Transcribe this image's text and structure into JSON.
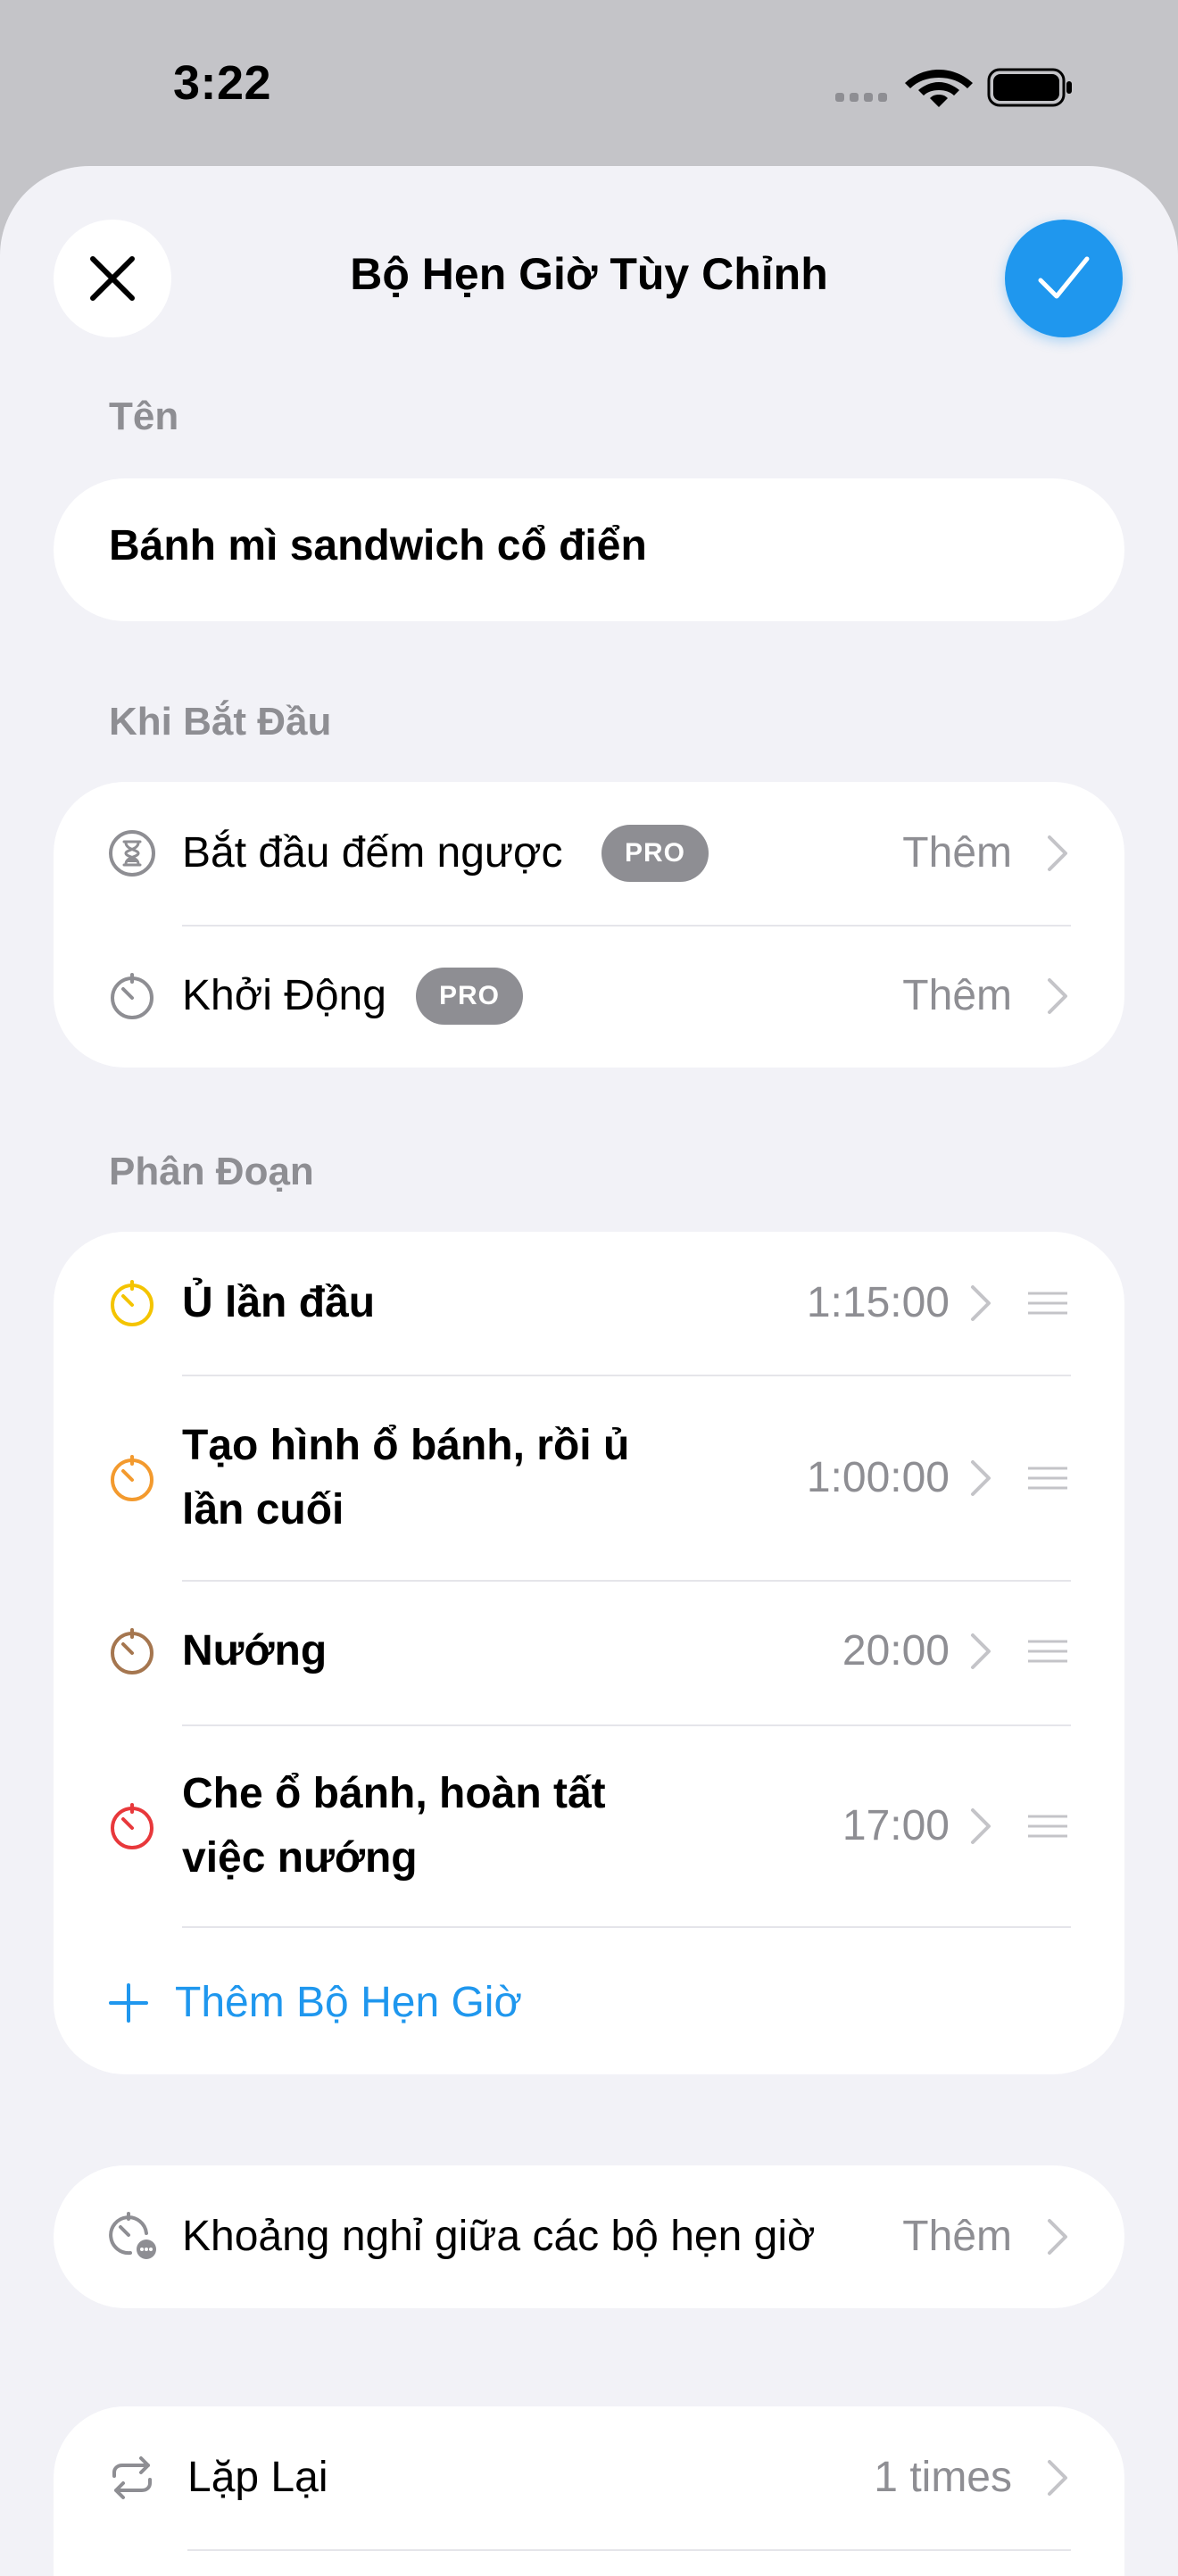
{
  "status": {
    "time": "3:22"
  },
  "header": {
    "title": "Bộ Hẹn Giờ Tùy Chỉnh"
  },
  "name_section": {
    "label": "Tên",
    "value": "Bánh mì sandwich cổ điển"
  },
  "start_section": {
    "label": "Khi Bắt Đầu",
    "items": [
      {
        "label": "Bắt đầu đếm ngược",
        "badge": "PRO",
        "value": "Thêm",
        "icon": "hourglass-icon"
      },
      {
        "label": "Khởi Động",
        "badge": "PRO",
        "value": "Thêm",
        "icon": "timer-icon"
      }
    ]
  },
  "segments_section": {
    "label": "Phân Đoạn",
    "items": [
      {
        "line1": "Ủ lần đầu",
        "line2": "",
        "duration": "1:15:00",
        "color": "#f4c400"
      },
      {
        "line1": "Tạo hình ổ bánh, rồi ủ",
        "line2": "lần cuối",
        "duration": "1:00:00",
        "color": "#f39a2e"
      },
      {
        "line1": "Nướng",
        "line2": "",
        "duration": "20:00",
        "color": "#a5764f"
      },
      {
        "line1": "Che ổ bánh, hoàn tất",
        "line2": "việc nướng",
        "duration": "17:00",
        "color": "#e8383b"
      }
    ],
    "add_label": "Thêm Bộ Hẹn Giờ"
  },
  "rest_row": {
    "label": "Khoảng nghỉ giữa các bộ hẹn giờ",
    "value": "Thêm"
  },
  "repeat_row": {
    "label": "Lặp Lại",
    "value": "1 times"
  },
  "colors": {
    "accent": "#1f97ee",
    "secondary_text": "#8e8e93",
    "background": "#f2f2f7"
  }
}
